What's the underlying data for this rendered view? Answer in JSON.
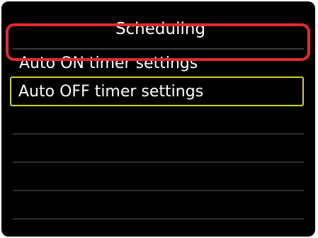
{
  "screen": {
    "title": "Scheduling"
  },
  "menu": {
    "items": [
      {
        "label": "Auto ON timer settings",
        "selected": false
      },
      {
        "label": "Auto OFF timer settings",
        "selected": true
      }
    ]
  },
  "colors": {
    "background": "#000000",
    "text": "#ffffff",
    "selection_border": "#d4d02a",
    "callout_ring": "#e4292c"
  }
}
